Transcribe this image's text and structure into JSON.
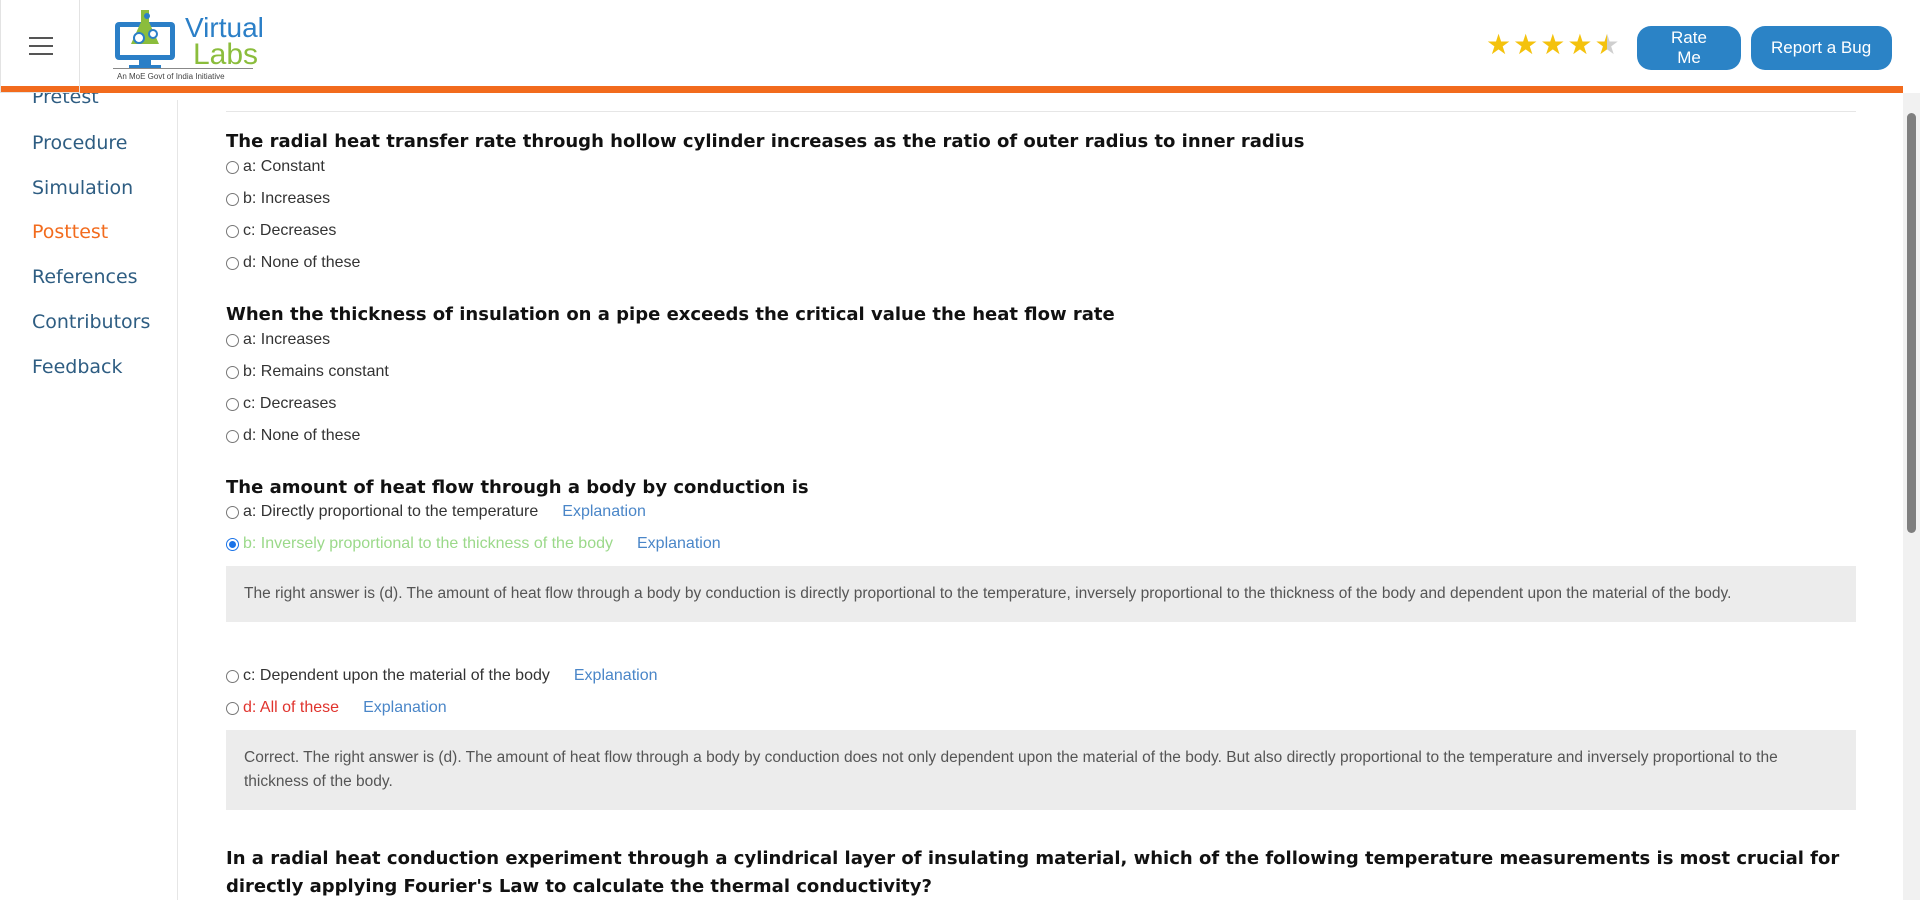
{
  "header": {
    "logo_top": "Virtual",
    "logo_bottom": "Labs",
    "logo_tag": "An MoE Govt of India Initiative",
    "rating": 4.5,
    "rate_label": "Rate Me",
    "bug_label": "Report a Bug"
  },
  "sidebar": {
    "items": [
      {
        "label": "Pretest"
      },
      {
        "label": "Procedure"
      },
      {
        "label": "Simulation"
      },
      {
        "label": "Posttest"
      },
      {
        "label": "References"
      },
      {
        "label": "Contributors"
      },
      {
        "label": "Feedback"
      }
    ]
  },
  "questions": [
    {
      "text": "The radial heat transfer rate through hollow cylinder increases as the ratio of outer radius to inner radius",
      "options": [
        "a: Constant",
        "b: Increases",
        "c: Decreases",
        "d: None of these"
      ]
    },
    {
      "text": "When the thickness of insulation on a pipe exceeds the critical value the heat flow rate",
      "options": [
        "a: Increases",
        "b: Remains constant",
        "c: Decreases",
        "d: None of these"
      ]
    },
    {
      "text": "The amount of heat flow through a body by conduction is",
      "options": [
        "a: Directly proportional to the temperature",
        "b: Inversely proportional to the thickness of the body",
        "c: Dependent upon the material of the body",
        "d: All of these"
      ],
      "explanation_label": "Explanation",
      "explanation_b": "The right answer is (d). The amount of heat flow through a body by conduction is directly proportional to the temperature, inversely proportional to the thickness of the body and dependent upon the material of the body.",
      "explanation_d": "Correct. The right answer is (d). The amount of heat flow through a body by conduction does not only dependent upon the material of the body. But also directly proportional to the temperature and inversely proportional to the thickness of the body."
    },
    {
      "text": "In a radial heat conduction experiment through a cylindrical layer of insulating material, which of the following temperature measurements is most crucial for directly applying Fourier's Law to calculate the thermal conductivity?"
    }
  ],
  "colors": {
    "accent": "#f26b1d",
    "button": "#2b83c6",
    "link": "#4a86c8",
    "correct": "#e0332d",
    "selected_wrong": "#9bd98a"
  }
}
